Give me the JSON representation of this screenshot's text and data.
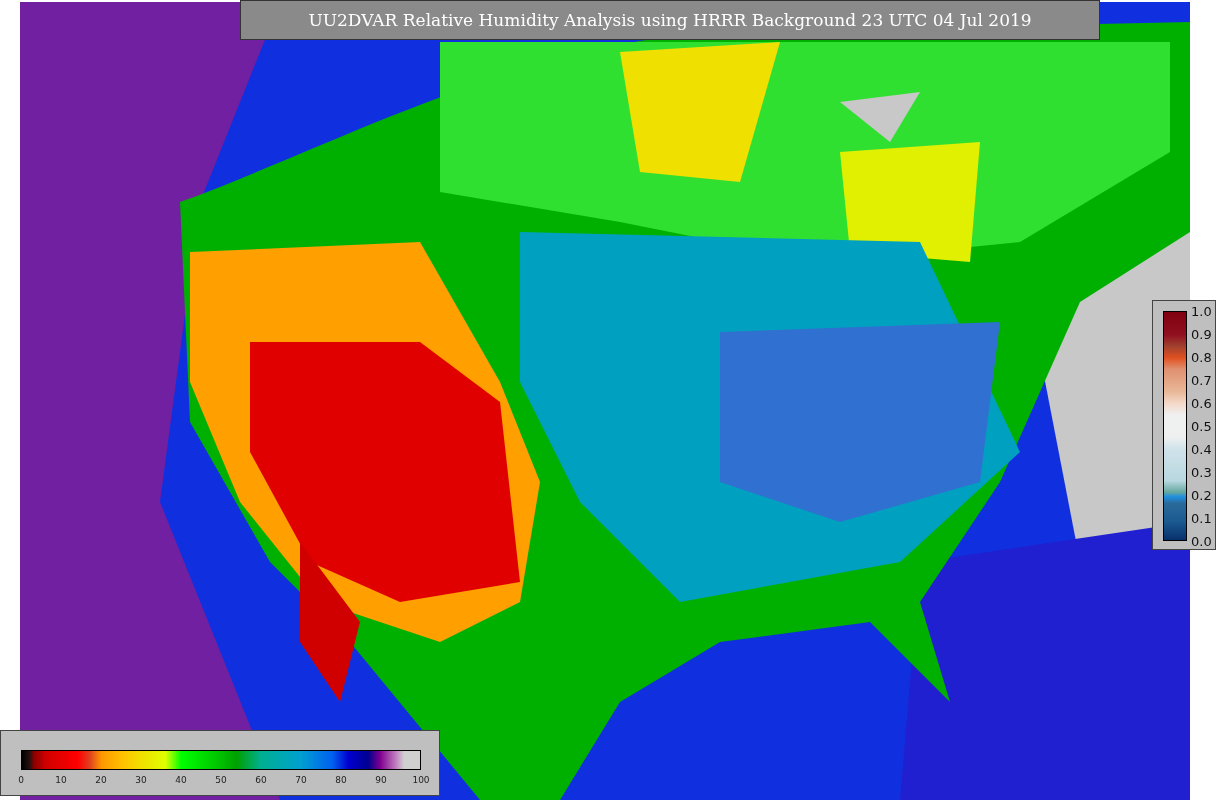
{
  "title": "UU2DVAR Relative Humidity Analysis using HRRR Background 23 UTC 04 Jul 2019",
  "horizontal_colorbar": {
    "ticks": [
      "0",
      "10",
      "20",
      "30",
      "40",
      "50",
      "60",
      "70",
      "80",
      "90",
      "100"
    ]
  },
  "vertical_colorbar": {
    "ticks": [
      "1.0",
      "0.9",
      "0.8",
      "0.7",
      "0.6",
      "0.5",
      "0.4",
      "0.3",
      "0.2",
      "0.1",
      "0.0"
    ]
  }
}
